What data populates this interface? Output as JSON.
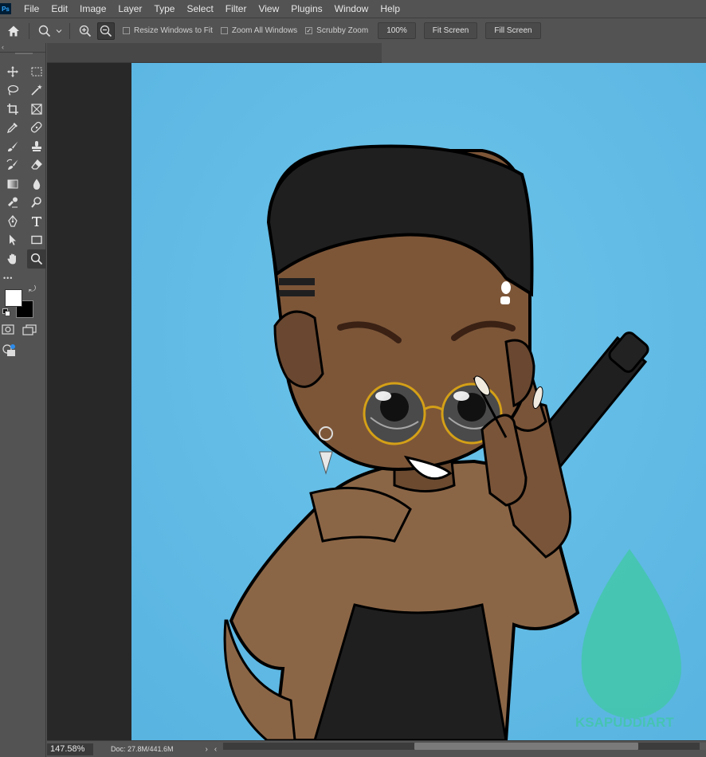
{
  "app": {
    "logo_text": "Ps"
  },
  "menu": [
    "File",
    "Edit",
    "Image",
    "Layer",
    "Type",
    "Select",
    "Filter",
    "View",
    "Plugins",
    "Window",
    "Help"
  ],
  "options": {
    "resize_windows": {
      "label": "Resize Windows to Fit",
      "checked": false
    },
    "zoom_all_windows": {
      "label": "Zoom All Windows",
      "checked": false
    },
    "scrubby_zoom": {
      "label": "Scrubby Zoom",
      "checked": true
    },
    "zoom_value": "100%",
    "fit_screen": "Fit Screen",
    "fill_screen": "Fill Screen"
  },
  "toolbar": {
    "collapse_glyph": "‹",
    "tools": [
      "move-tool-icon",
      "marquee-tool-icon",
      "lasso-tool-icon",
      "magic-wand-icon",
      "crop-tool-icon",
      "frame-tool-icon",
      "eyedropper-icon",
      "healing-brush-icon",
      "brush-tool-icon",
      "clone-stamp-icon",
      "history-brush-icon",
      "eraser-icon",
      "gradient-tool-icon",
      "blur-tool-icon",
      "dodge-tool-icon",
      "smudge-tool-icon",
      "pen-tool-icon",
      "type-tool-icon",
      "path-selection-icon",
      "rectangle-tool-icon",
      "hand-tool-icon",
      "zoom-tool-icon"
    ],
    "selected_tool": "zoom-tool-icon",
    "more_glyph": "•••",
    "foreground_color": "#ffffff",
    "background_color": "#000000"
  },
  "status": {
    "zoom": "147.58%",
    "doc_info": "Doc: 27.8M/441.6M",
    "expand_glyph": "›",
    "scroll_left_glyph": "‹"
  },
  "canvas": {
    "background_color": "#63bde6",
    "watermark_text": "KSAPUDDIART"
  }
}
